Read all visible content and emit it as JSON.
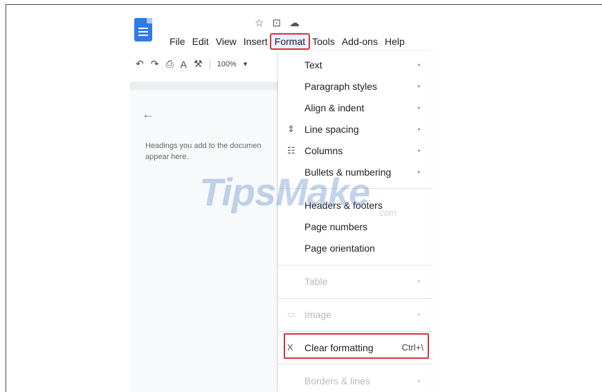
{
  "menubar": [
    "File",
    "Edit",
    "View",
    "Insert",
    "Format",
    "Tools",
    "Add-ons",
    "Help"
  ],
  "title_icons": {
    "star": "☆",
    "move": "⊡",
    "cloud": "☁"
  },
  "toolbar": {
    "undo": "↶",
    "redo": "↷",
    "print": "⎙",
    "spell": "A",
    "paint": "⚒",
    "zoom": "100%",
    "zoom_arrow": "▾"
  },
  "outline": {
    "back": "←",
    "text": "Headings you add to the documen\nappear here."
  },
  "format_menu": {
    "items": [
      {
        "label": "Text",
        "arrow": "▸"
      },
      {
        "label": "Paragraph styles",
        "arrow": "▸"
      },
      {
        "label": "Align & indent",
        "arrow": "▸"
      },
      {
        "label": "Line spacing",
        "arrow": "▸",
        "icon": "⇕"
      },
      {
        "label": "Columns",
        "arrow": "▸",
        "icon": "☷"
      },
      {
        "label": "Bullets & numbering",
        "arrow": "▸"
      },
      {
        "label": "Headers & footers"
      },
      {
        "label": "Page numbers"
      },
      {
        "label": "Page orientation"
      },
      {
        "label": "Table",
        "arrow": "▸"
      },
      {
        "label": "Image",
        "arrow": "▸",
        "icon": "▭"
      },
      {
        "label": "Clear formatting",
        "shortcut": "Ctrl+\\",
        "icon": "X"
      },
      {
        "label": "Borders & lines",
        "arrow": "▸"
      }
    ]
  },
  "watermark": {
    "main": "TipsMake",
    "suffix": ".com"
  },
  "colors": {
    "highlight": "#d8323c",
    "doc_blue": "#2f7be5"
  }
}
